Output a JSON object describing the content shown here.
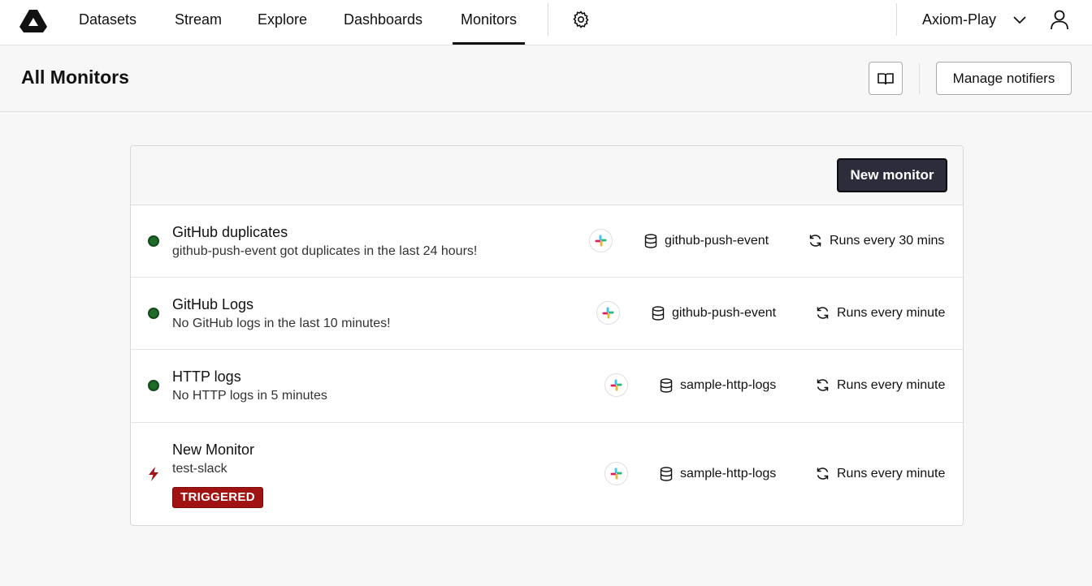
{
  "nav": {
    "items": [
      {
        "label": "Datasets"
      },
      {
        "label": "Stream"
      },
      {
        "label": "Explore"
      },
      {
        "label": "Dashboards"
      },
      {
        "label": "Monitors",
        "active": true
      }
    ],
    "org_name": "Axiom-Play"
  },
  "header": {
    "title": "All Monitors",
    "manage_label": "Manage notifiers"
  },
  "card": {
    "new_monitor_label": "New monitor"
  },
  "monitors": [
    {
      "name": "GitHub duplicates",
      "description": "github-push-event got duplicates in the last 24 hours!",
      "status": "ok",
      "notifier": "slack-icon",
      "dataset": "github-push-event",
      "schedule": "Runs every 30 mins"
    },
    {
      "name": "GitHub Logs",
      "description": "No GitHub logs in the last 10 minutes!",
      "status": "ok",
      "notifier": "slack-icon",
      "dataset": "github-push-event",
      "schedule": "Runs every minute"
    },
    {
      "name": "HTTP logs",
      "description": "No HTTP logs in 5 minutes",
      "status": "ok",
      "notifier": "slack-icon",
      "dataset": "sample-http-logs",
      "schedule": "Runs every minute"
    },
    {
      "name": "New Monitor",
      "description": "test-slack",
      "status": "triggered",
      "badge": "TRIGGERED",
      "notifier": "slack-icon",
      "dataset": "sample-http-logs",
      "schedule": "Runs every minute"
    }
  ],
  "colors": {
    "ok": "#1f6b2a",
    "triggered": "#a11313",
    "primary_button": "#2c2c3a"
  }
}
